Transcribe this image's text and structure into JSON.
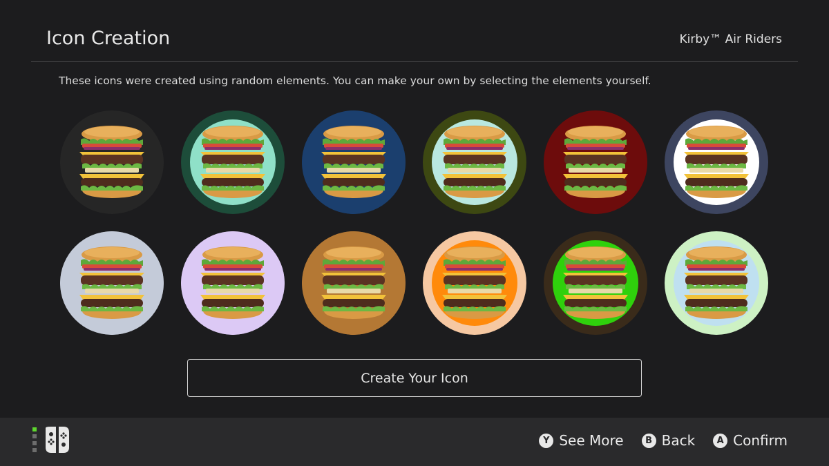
{
  "header": {
    "title": "Icon Creation",
    "game_name": "Kirby™ Air Riders"
  },
  "description": "These icons were created using random elements. You can make your own by selecting the elements yourself.",
  "icons": [
    {
      "ring": "#262626",
      "bg": "#262626"
    },
    {
      "ring": "#1d4d3a",
      "bg": "#8fe0c8"
    },
    {
      "ring": "#1b3f6e",
      "bg": "#1b3f6e"
    },
    {
      "ring": "#3d4812",
      "bg": "#b9e8e0"
    },
    {
      "ring": "#6d0c0c",
      "bg": "#6d0c0c"
    },
    {
      "ring": "#3d4560",
      "bg": "#ffffff"
    },
    {
      "ring": "#c4cbd9",
      "bg": "#c4cbd9"
    },
    {
      "ring": "#dcc9f5",
      "bg": "#dcc9f5"
    },
    {
      "ring": "#b47834",
      "bg": "#b47834"
    },
    {
      "ring": "#f6c8a2",
      "bg": "#ff8a0b"
    },
    {
      "ring": "#3a2b1a",
      "bg": "#2fd10c"
    },
    {
      "ring": "#cdf1c4",
      "bg": "#bfe0f0"
    }
  ],
  "create_button": "Create Your Icon",
  "footer": {
    "hints": [
      {
        "button": "Y",
        "label": "See More"
      },
      {
        "button": "B",
        "label": "Back"
      },
      {
        "button": "A",
        "label": "Confirm"
      }
    ]
  }
}
